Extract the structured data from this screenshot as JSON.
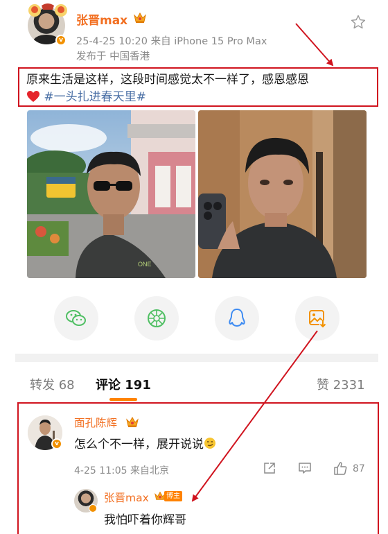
{
  "post": {
    "author": "张晋max",
    "meta": "25-4-25 10:20  来自 iPhone 15 Pro Max",
    "location": "发布于 中国香港",
    "text_line1": "原来生活是这样，这段时间感觉太不一样了，感恩感恩",
    "hashtag": "#一头扎进春天里#",
    "verified_badge": "v",
    "photos": [
      "street-selfie-with-sunglasses",
      "mirror-selfie"
    ]
  },
  "share": {
    "items": [
      "wechat-icon",
      "moments-icon",
      "qq-icon",
      "save-image-icon"
    ]
  },
  "tabs": {
    "repost_label": "转发",
    "repost_count": "68",
    "comment_label": "评论",
    "comment_count": "191",
    "like_label": "赞",
    "like_count": "2331"
  },
  "comment": {
    "author": "面孔陈辉",
    "text": "怎么个不一样，展开说说",
    "meta": "4-25 11:05  来自北京",
    "likes": "87",
    "reply": {
      "author": "张晋max",
      "tag": "博主",
      "text": "我怕吓着你辉哥"
    }
  },
  "colors": {
    "accent": "#ff8200",
    "username": "#f26f21",
    "hashtag": "#4a6fa5",
    "annotation": "#d0141f"
  }
}
